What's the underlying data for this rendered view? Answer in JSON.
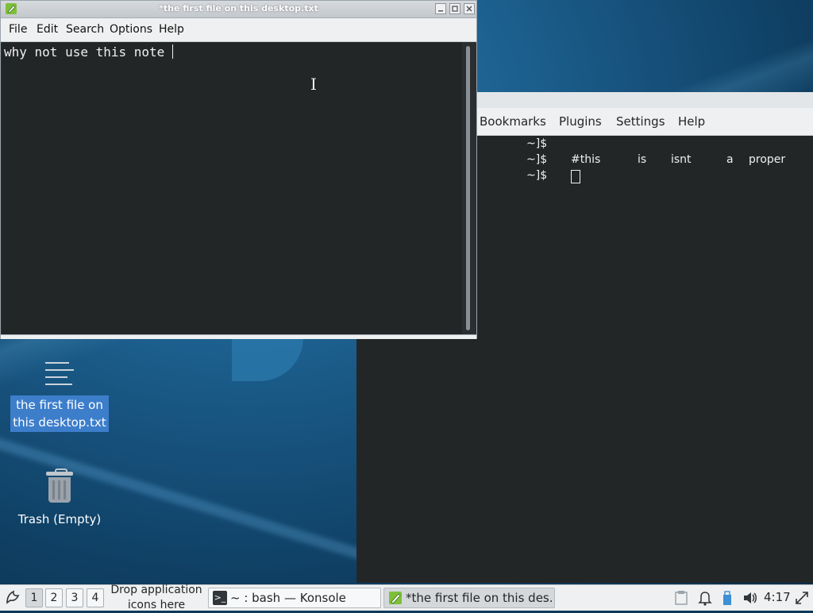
{
  "editor": {
    "title": "*the first file on this desktop.txt",
    "menu": [
      "File",
      "Edit",
      "Search",
      "Options",
      "Help"
    ],
    "content": "why not use this note ",
    "window_buttons": [
      "minimize",
      "maximize",
      "close"
    ]
  },
  "konsole": {
    "menu": [
      "Bookmarks",
      "Plugins",
      "Settings",
      "Help"
    ],
    "lines": [
      {
        "prompt": "~]$",
        "words": []
      },
      {
        "prompt": "~]$",
        "words": [
          "#this",
          "is",
          "isnt",
          "a",
          "proper"
        ]
      },
      {
        "prompt": "~]$",
        "words": []
      }
    ]
  },
  "desktop": {
    "icons": [
      {
        "label_line1": "the first file on",
        "label_line2": "this desktop.txt",
        "icon": "text-file-icon"
      },
      {
        "label": "Trash (Empty)",
        "icon": "trash-icon"
      }
    ]
  },
  "taskbar": {
    "desktops": [
      "1",
      "2",
      "3",
      "4"
    ],
    "active_desktop": "1",
    "drop_text_line1": "Drop application",
    "drop_text_line2": "icons here",
    "tasks": [
      {
        "label": "~ : bash — Konsole",
        "icon": "terminal-icon",
        "active": false
      },
      {
        "label": "*the first file on this des...",
        "icon": "leafpad-icon",
        "active": true
      }
    ],
    "tray": [
      "clipboard-icon",
      "bell-icon",
      "usb-icon",
      "volume-icon"
    ],
    "clock": "4:17"
  },
  "colors": {
    "terminal_bg": "#232627",
    "selection": "#3d7ecb",
    "desktop_bg": "#1c5f8e"
  }
}
